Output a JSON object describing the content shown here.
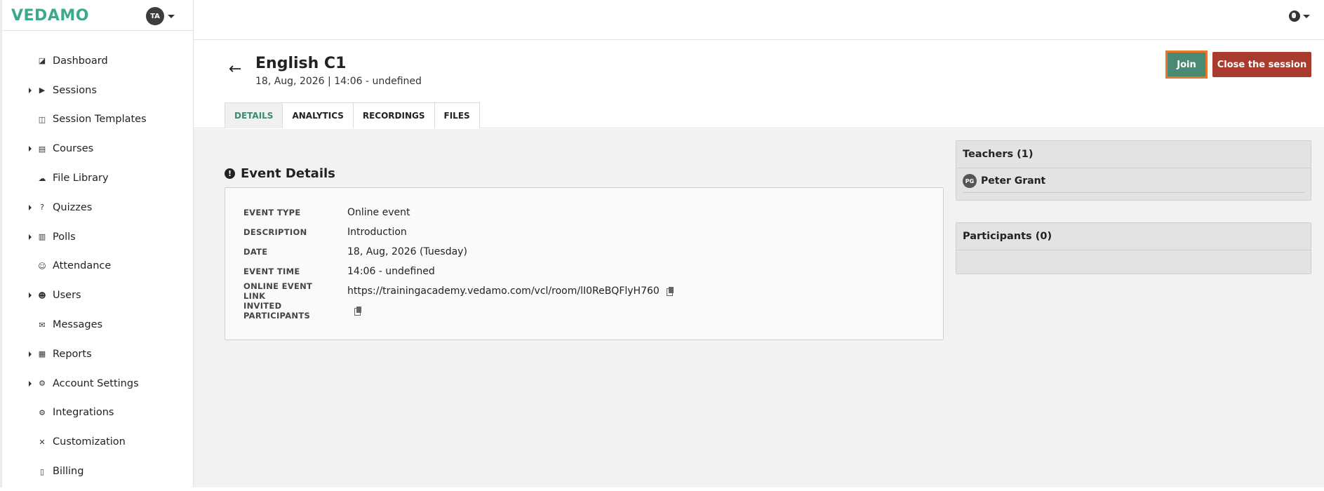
{
  "app": {
    "logo": "VEDAMO",
    "user_initials": "TA"
  },
  "sidebar": {
    "items": [
      {
        "label": "Dashboard",
        "icon": "dashboard-icon",
        "expandable": false
      },
      {
        "label": "Sessions",
        "icon": "play-icon",
        "expandable": true
      },
      {
        "label": "Session Templates",
        "icon": "template-icon",
        "expandable": false
      },
      {
        "label": "Courses",
        "icon": "book-icon",
        "expandable": true
      },
      {
        "label": "File Library",
        "icon": "cloud-icon",
        "expandable": false
      },
      {
        "label": "Quizzes",
        "icon": "question-icon",
        "expandable": true
      },
      {
        "label": "Polls",
        "icon": "bar-chart-icon",
        "expandable": true
      },
      {
        "label": "Attendance",
        "icon": "attendance-icon",
        "expandable": false
      },
      {
        "label": "Users",
        "icon": "users-icon",
        "expandable": true
      },
      {
        "label": "Messages",
        "icon": "envelope-icon",
        "expandable": false
      },
      {
        "label": "Reports",
        "icon": "report-icon",
        "expandable": true
      },
      {
        "label": "Account Settings",
        "icon": "gear-icon",
        "expandable": true
      },
      {
        "label": "Integrations",
        "icon": "cogs-icon",
        "expandable": false
      },
      {
        "label": "Customization",
        "icon": "tools-icon",
        "expandable": false
      },
      {
        "label": "Billing",
        "icon": "receipt-icon",
        "expandable": false
      }
    ]
  },
  "header": {
    "title": "English C1",
    "subtitle": "18, Aug, 2026 | 14:06 - undefined",
    "join_label": "Join",
    "close_label": "Close the session",
    "tabs": [
      "DETAILS",
      "ANALYTICS",
      "RECORDINGS",
      "FILES"
    ],
    "active_tab": "DETAILS"
  },
  "details": {
    "heading": "Event Details",
    "rows": [
      {
        "label": "EVENT TYPE",
        "value": "Online event"
      },
      {
        "label": "DESCRIPTION",
        "value": "Introduction"
      },
      {
        "label": "DATE",
        "value": "18, Aug, 2026 (Tuesday)"
      },
      {
        "label": "EVENT TIME",
        "value": "14:06 - undefined"
      },
      {
        "label": "ONLINE EVENT LINK",
        "value": "https://trainingacademy.vedamo.com/vcl/room/lI0ReBQFlyH760"
      },
      {
        "label": "INVITED PARTICIPANTS",
        "value": ""
      }
    ]
  },
  "teachers": {
    "heading": "Teachers (1)",
    "list": [
      {
        "initials": "PG",
        "name": "Peter Grant"
      }
    ]
  },
  "participants": {
    "heading": "Participants (0)"
  },
  "colors": {
    "brand": "#3aaa8c",
    "join": "#4a8a72",
    "join_outline": "#e8762a",
    "close": "#a93a2e"
  }
}
